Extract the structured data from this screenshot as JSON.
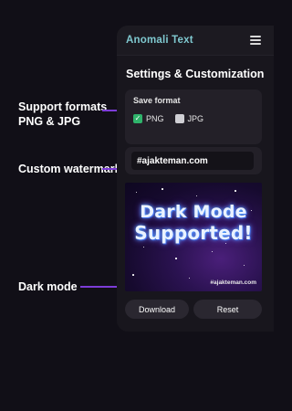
{
  "annotations": {
    "formats_line1": "Support formats",
    "formats_line2": "PNG & JPG",
    "watermark": "Custom watermark",
    "dark_mode": "Dark mode"
  },
  "app": {
    "title": "Anomali Text",
    "section_title": "Settings & Customization"
  },
  "save_format": {
    "label": "Save format",
    "options": [
      {
        "label": "PNG",
        "checked": true
      },
      {
        "label": "JPG",
        "checked": false
      }
    ]
  },
  "watermark": {
    "value": "#ajakteman.com"
  },
  "preview": {
    "line1": "Dark Mode",
    "line2": "Supported!",
    "watermark": "#ajakteman.com"
  },
  "actions": {
    "download_label": "Download",
    "reset_label": "Reset"
  },
  "colors": {
    "accent_arrow": "#7d3cd8",
    "title_color": "#7fc8cf",
    "checked": "#2fb46b",
    "background": "#110f17"
  }
}
